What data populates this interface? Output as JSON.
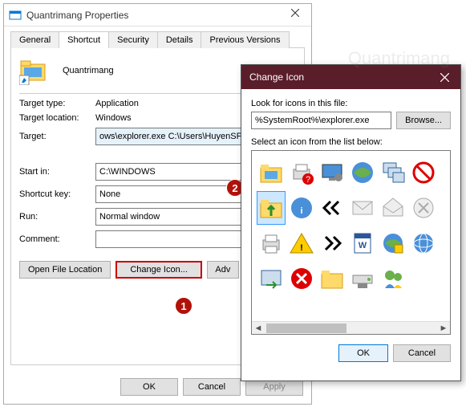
{
  "props": {
    "title": "Quantrimang Properties",
    "tabs": [
      "General",
      "Shortcut",
      "Security",
      "Details",
      "Previous Versions"
    ],
    "active_tab": 1,
    "shortcut_name": "Quantrimang",
    "fields": {
      "target_type_label": "Target type:",
      "target_type_value": "Application",
      "target_location_label": "Target location:",
      "target_location_value": "Windows",
      "target_label": "Target:",
      "target_value": "ows\\explorer.exe C:\\Users\\HuyenSP\\",
      "start_in_label": "Start in:",
      "start_in_value": "C:\\WINDOWS",
      "shortcut_key_label": "Shortcut key:",
      "shortcut_key_value": "None",
      "run_label": "Run:",
      "run_value": "Normal window",
      "comment_label": "Comment:",
      "comment_value": ""
    },
    "buttons": {
      "open_file_location": "Open File Location",
      "change_icon": "Change Icon...",
      "advanced": "Adv"
    },
    "footer": {
      "ok": "OK",
      "cancel": "Cancel",
      "apply": "Apply"
    }
  },
  "change_icon": {
    "title": "Change Icon",
    "look_label": "Look for icons in this file:",
    "path_value": "%SystemRoot%\\explorer.exe",
    "browse": "Browse...",
    "select_label": "Select an icon from the list below:",
    "ok": "OK",
    "cancel": "Cancel",
    "icons": [
      "folder-icon",
      "printer-question-icon",
      "monitor-gear-icon",
      "globe-icon",
      "cascade-windows-icon",
      "no-entry-icon",
      "folder-up-icon",
      "info-icon",
      "double-chevron-left-icon",
      "mail-icon",
      "mail-open-icon",
      "cancel-grey-icon",
      "printer-icon",
      "warning-icon",
      "double-chevron-right-icon",
      "word-doc-icon",
      "globe-lock-icon",
      "globe-net-icon",
      "window-arrow-icon",
      "error-red-icon",
      "folder-plain-icon",
      "drive-network-icon",
      "msn-user-icon",
      "blank-icon"
    ],
    "selected_index": 6
  },
  "badges": {
    "one": "1",
    "two": "2"
  },
  "watermark": "Quantrimang"
}
